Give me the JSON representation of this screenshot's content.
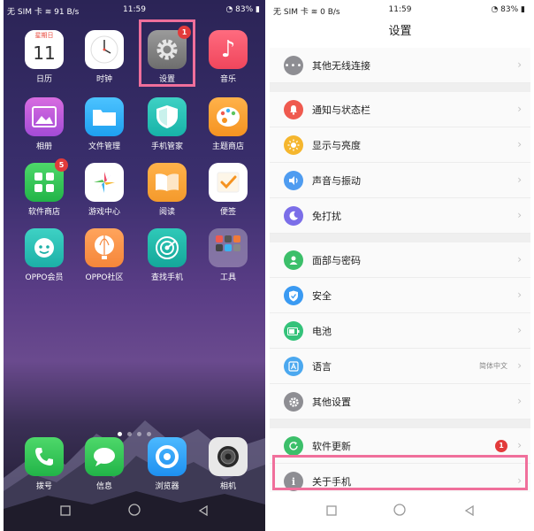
{
  "home": {
    "status": {
      "carrier": "无 SIM 卡",
      "speed": "91 B/s",
      "time": "11:59",
      "battery": "83%"
    },
    "apps": [
      {
        "label": "日历",
        "icon": "calendar-icon",
        "weekday": "星期日",
        "day": "11"
      },
      {
        "label": "时钟",
        "icon": "clock-icon"
      },
      {
        "label": "设置",
        "icon": "gear-icon",
        "badge": "1"
      },
      {
        "label": "音乐",
        "icon": "music-note-icon"
      },
      {
        "label": "相册",
        "icon": "photo-album-icon"
      },
      {
        "label": "文件管理",
        "icon": "folder-icon"
      },
      {
        "label": "手机管家",
        "icon": "shield-icon"
      },
      {
        "label": "主题商店",
        "icon": "palette-icon"
      },
      {
        "label": "软件商店",
        "icon": "app-store-icon",
        "badge": "5"
      },
      {
        "label": "游戏中心",
        "icon": "game-center-icon"
      },
      {
        "label": "阅读",
        "icon": "book-icon"
      },
      {
        "label": "便签",
        "icon": "checkmark-note-icon"
      },
      {
        "label": "OPPO会员",
        "icon": "oppo-member-icon"
      },
      {
        "label": "OPPO社区",
        "icon": "balloon-icon"
      },
      {
        "label": "查找手机",
        "icon": "radar-icon"
      },
      {
        "label": "工具",
        "icon": "folder-tools-icon"
      }
    ],
    "dock": [
      {
        "label": "拨号",
        "icon": "phone-icon"
      },
      {
        "label": "信息",
        "icon": "message-icon"
      },
      {
        "label": "浏览器",
        "icon": "browser-icon"
      },
      {
        "label": "相机",
        "icon": "camera-icon"
      }
    ]
  },
  "settings": {
    "status": {
      "carrier": "无 SIM 卡",
      "speed": "0 B/s",
      "time": "11:59",
      "battery": "83%"
    },
    "title": "设置",
    "groups": [
      [
        {
          "label": "其他无线连接",
          "icon": "more-dots-icon",
          "color": "#8e8e93"
        }
      ],
      [
        {
          "label": "通知与状态栏",
          "icon": "notification-icon",
          "color": "#ef5a4f"
        },
        {
          "label": "显示与亮度",
          "icon": "sun-icon",
          "color": "#f5b62e"
        },
        {
          "label": "声音与振动",
          "icon": "speaker-icon",
          "color": "#4f9cf0"
        },
        {
          "label": "免打扰",
          "icon": "moon-icon",
          "color": "#7b6ee8"
        }
      ],
      [
        {
          "label": "面部与密码",
          "icon": "face-lock-icon",
          "color": "#3cbf6a"
        },
        {
          "label": "安全",
          "icon": "shield-check-icon",
          "color": "#3a9af2"
        },
        {
          "label": "电池",
          "icon": "battery-icon",
          "color": "#34c27a"
        },
        {
          "label": "语言",
          "icon": "language-icon",
          "color": "#4ba8ef",
          "value": "简体中文"
        },
        {
          "label": "其他设置",
          "icon": "gear-icon",
          "color": "#8e8e93"
        }
      ],
      [
        {
          "label": "软件更新",
          "icon": "update-icon",
          "color": "#3cbf6a",
          "badge": "1"
        },
        {
          "label": "关于手机",
          "icon": "info-icon",
          "color": "#8e8e93"
        }
      ]
    ]
  }
}
